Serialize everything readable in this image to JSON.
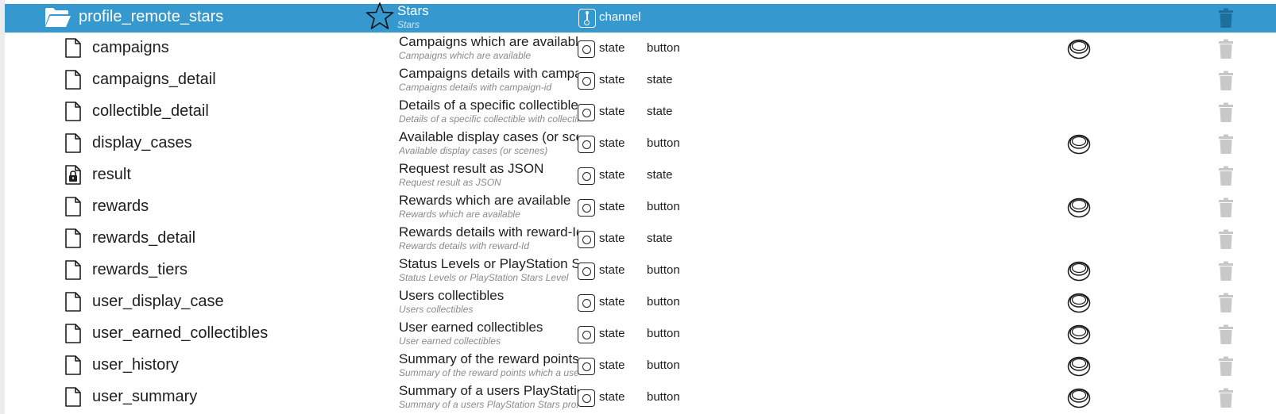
{
  "folder": {
    "name": "profile_remote_stars",
    "desc_main": "Stars",
    "desc_sub": "Stars",
    "role": "channel",
    "icon": "folder-open-icon",
    "role_icon": "channel-icon"
  },
  "rows": [
    {
      "name": "campaigns",
      "icon": "file-icon",
      "desc_main": "Campaigns which are available",
      "desc_sub": "Campaigns which are available",
      "role": "state",
      "type": "button",
      "has_button": true
    },
    {
      "name": "campaigns_detail",
      "icon": "file-icon",
      "desc_main": "Campaigns details with campaign-id",
      "desc_sub": "Campaigns details with campaign-id",
      "role": "state",
      "type": "state",
      "has_button": false
    },
    {
      "name": "collectible_detail",
      "icon": "file-icon",
      "desc_main": "Details of a specific collectible",
      "desc_sub": "Details of a specific collectible with collectible-id",
      "role": "state",
      "type": "state",
      "has_button": false
    },
    {
      "name": "display_cases",
      "icon": "file-icon",
      "desc_main": "Available display cases (or scenes)",
      "desc_sub": "Available display cases (or scenes)",
      "role": "state",
      "type": "button",
      "has_button": true
    },
    {
      "name": "result",
      "icon": "file-locked-icon",
      "desc_main": "Request result as JSON",
      "desc_sub": "Request result as JSON",
      "role": "state",
      "type": "state",
      "has_button": false
    },
    {
      "name": "rewards",
      "icon": "file-icon",
      "desc_main": "Rewards which are available",
      "desc_sub": "Rewards which are available",
      "role": "state",
      "type": "button",
      "has_button": true
    },
    {
      "name": "rewards_detail",
      "icon": "file-icon",
      "desc_main": "Rewards details with reward-Id",
      "desc_sub": "Rewards details with reward-Id",
      "role": "state",
      "type": "state",
      "has_button": false
    },
    {
      "name": "rewards_tiers",
      "icon": "file-icon",
      "desc_main": "Status Levels or PlayStation Stars Level",
      "desc_sub": "Status Levels or PlayStation Stars Level",
      "role": "state",
      "type": "button",
      "has_button": true
    },
    {
      "name": "user_display_case",
      "icon": "file-icon",
      "desc_main": "Users collectibles",
      "desc_sub": "Users collectibles",
      "role": "state",
      "type": "button",
      "has_button": true
    },
    {
      "name": "user_earned_collectibles",
      "icon": "file-icon",
      "desc_main": "User earned collectibles",
      "desc_sub": "User earned collectibles",
      "role": "state",
      "type": "button",
      "has_button": true
    },
    {
      "name": "user_history",
      "icon": "file-icon",
      "desc_main": "Summary of the reward points which a user",
      "desc_sub": "Summary of the reward points which a user",
      "role": "state",
      "type": "button",
      "has_button": true
    },
    {
      "name": "user_summary",
      "icon": "file-icon",
      "desc_main": "Summary of a users PlayStation Stars profile",
      "desc_sub": "Summary of a users PlayStation Stars profile",
      "role": "state",
      "type": "button",
      "has_button": true
    }
  ],
  "colors": {
    "selection": "#3598cf",
    "trash": "#c8c8c8",
    "subtext": "#8a8a8a"
  }
}
